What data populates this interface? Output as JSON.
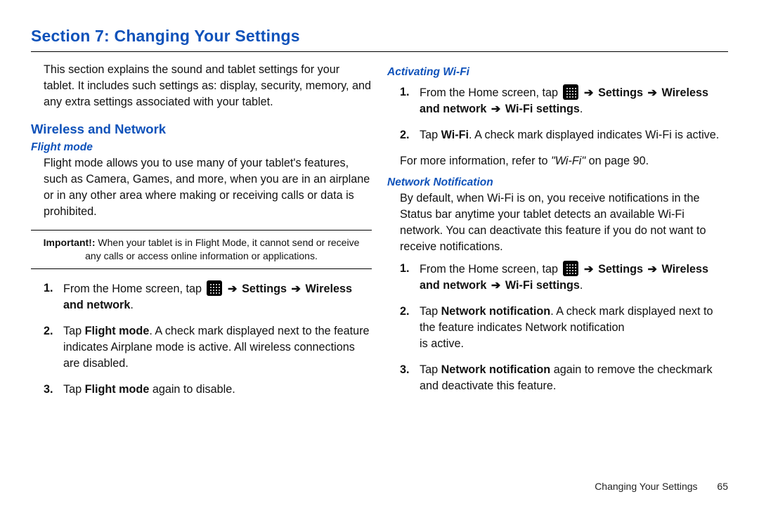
{
  "section_title": "Section 7: Changing Your Settings",
  "intro": "This section explains the sound and tablet settings for your tablet. It includes such settings as: display, security, memory, and any extra settings associated with your tablet.",
  "h2_wireless": "Wireless and Network",
  "flight": {
    "heading": "Flight mode",
    "para": "Flight mode allows you to use many of your tablet's features, such as Camera, Games, and more, when you are in an airplane or in any other area where making or receiving calls or data is prohibited.",
    "important_label": "Important!:",
    "important_text": " When your tablet is in Flight Mode, it cannot send or receive any calls or access online information or applications.",
    "step1_pre": "From the Home screen, tap ",
    "arrow": "➔",
    "settings": "Settings",
    "wireless_and_network": "Wireless and network",
    "step1_post": ".",
    "step2_pre": "Tap ",
    "step2_bold": "Flight mode",
    "step2_post": ". A check mark displayed next to the feature indicates Airplane mode is active. All wireless connections are disabled.",
    "step3_pre": "Tap ",
    "step3_bold": "Flight mode",
    "step3_post": " again to disable."
  },
  "wifi": {
    "heading": "Activating Wi-Fi",
    "step1_pre": "From the Home screen, tap ",
    "settings": "Settings",
    "arrow": "➔",
    "wireless_and_network": "Wireless and network",
    "wifi_settings": "Wi-Fi settings",
    "step1_post": ".",
    "step2_pre": "Tap ",
    "step2_bold": "Wi-Fi",
    "step2_post": ". A check mark displayed indicates Wi-Fi is active.",
    "ref_pre": "For more information, refer to ",
    "ref_italic": "\"Wi-Fi\" ",
    "ref_post": " on page 90."
  },
  "netnotif": {
    "heading": "Network Notification",
    "para": "By default, when Wi-Fi is on, you receive notifications in the Status bar anytime your tablet detects an available Wi-Fi network. You can deactivate this feature if you do not want to receive notifications.",
    "step1_pre": "From the Home screen, tap ",
    "settings": "Settings",
    "arrow": "➔",
    "wireless_and_network": "Wireless and network",
    "wifi_settings": "Wi-Fi settings",
    "step1_post": ".",
    "step2_pre": "Tap ",
    "step2_bold": "Network notification",
    "step2_post": ". A check mark displayed next to the feature indicates Network notification",
    "step2_tail": "is active.",
    "step3_pre": "Tap ",
    "step3_bold": "Network notification",
    "step3_post": " again to remove the checkmark and deactivate this feature."
  },
  "footer_text": "Changing Your Settings",
  "page_number": "65",
  "nums": {
    "n1": "1.",
    "n2": "2.",
    "n3": "3."
  }
}
